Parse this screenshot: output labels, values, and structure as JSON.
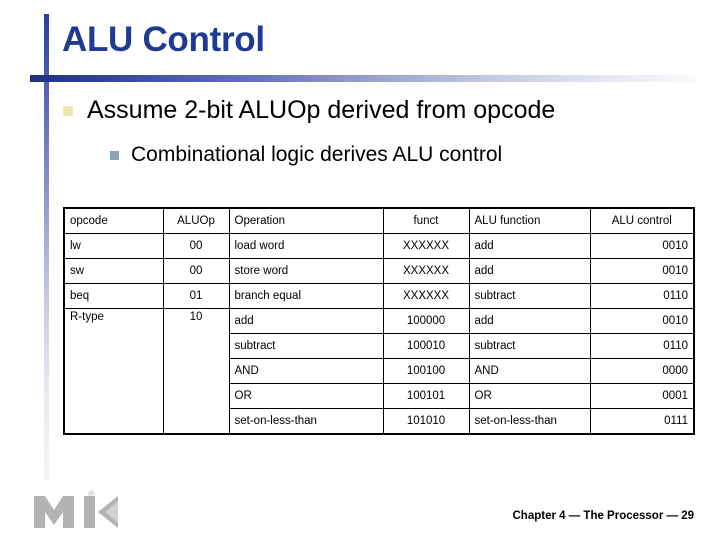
{
  "slide": {
    "title": "ALU Control",
    "bullet_level1": "Assume 2-bit ALUOp derived from opcode",
    "bullet_level2": "Combinational logic derives ALU control",
    "footer": "Chapter 4 — The Processor — 29",
    "logo_text": "MK",
    "logo_registered": "®",
    "accent_color": "#1f3a93",
    "bullet1_color": "#e8e8b0",
    "bullet2_color": "#8ea3b8"
  },
  "table": {
    "headers": [
      "opcode",
      "ALUOp",
      "Operation",
      "funct",
      "ALU function",
      "ALU control"
    ],
    "rows": [
      {
        "opcode": "lw",
        "aluop": "00",
        "operation": "load word",
        "funct": "XXXXXX",
        "alu_function": "add",
        "alu_control": "0010"
      },
      {
        "opcode": "sw",
        "aluop": "00",
        "operation": "store word",
        "funct": "XXXXXX",
        "alu_function": "add",
        "alu_control": "0010"
      },
      {
        "opcode": "beq",
        "aluop": "01",
        "operation": "branch equal",
        "funct": "XXXXXX",
        "alu_function": "subtract",
        "alu_control": "0110"
      },
      {
        "opcode": "R-type",
        "aluop": "10",
        "operation": "add",
        "funct": "100000",
        "alu_function": "add",
        "alu_control": "0010"
      },
      {
        "opcode": "",
        "aluop": "",
        "operation": "subtract",
        "funct": "100010",
        "alu_function": "subtract",
        "alu_control": "0110"
      },
      {
        "opcode": "",
        "aluop": "",
        "operation": "AND",
        "funct": "100100",
        "alu_function": "AND",
        "alu_control": "0000"
      },
      {
        "opcode": "",
        "aluop": "",
        "operation": "OR",
        "funct": "100101",
        "alu_function": "OR",
        "alu_control": "0001"
      },
      {
        "opcode": "",
        "aluop": "",
        "operation": "set-on-less-than",
        "funct": "101010",
        "alu_function": "set-on-less-than",
        "alu_control": "0111"
      }
    ]
  }
}
